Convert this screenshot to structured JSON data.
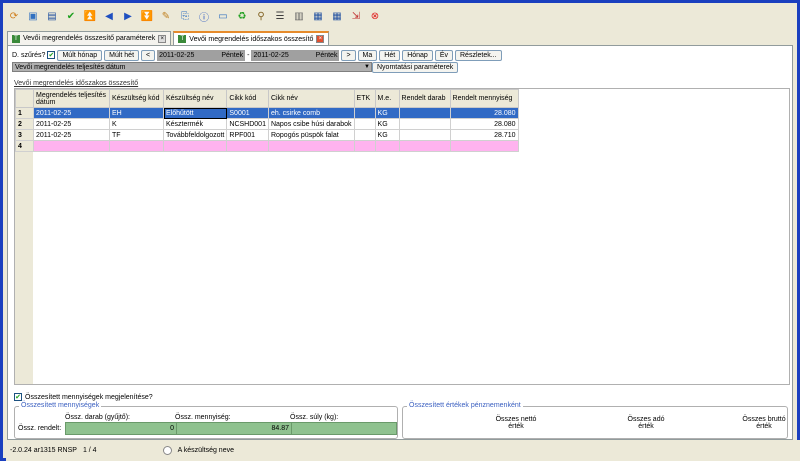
{
  "tabs": [
    {
      "label": "Vevői megrendelés összesítő paraméterek"
    },
    {
      "label": "Vevői megrendelés időszakos összesítő"
    }
  ],
  "filter": {
    "d_szures_label": "D. szűrés?",
    "mult_honap": "Múlt hónap",
    "mult_het": "Múlt hét",
    "prev": "<",
    "next": ">",
    "date_from": "2011-02-25",
    "day_from": "Péntek",
    "dash": "-",
    "date_to": "2011-02-25",
    "day_to": "Péntek",
    "ma": "Ma",
    "het": "Hét",
    "honap": "Hónap",
    "ev": "Év",
    "reszletek": "Részletek..."
  },
  "dropdown": {
    "value": "Vevői megrendelés teljesítés dátum",
    "print_btn": "Nyomtatási paraméterek"
  },
  "grid": {
    "title": "Vevői megrendelés időszakos összesítő",
    "columns": [
      "Megrendelés teljesítés dátum",
      "Készültség kód",
      "Készültség név",
      "Cikk kód",
      "Cikk név",
      "ETK",
      "M.e.",
      "Rendelt darab",
      "Rendelt mennyiség"
    ],
    "rows": [
      {
        "n": "1",
        "cells": [
          "2011-02-25",
          "EH",
          "Előhűtött",
          "S0001",
          "eh. csirke comb",
          "",
          "KG",
          "",
          "28.080"
        ]
      },
      {
        "n": "2",
        "cells": [
          "2011-02-25",
          "K",
          "Késztermék",
          "NCSHD001",
          "Napos csibe húsi darabok",
          "",
          "KG",
          "",
          "28.080"
        ]
      },
      {
        "n": "3",
        "cells": [
          "2011-02-25",
          "TF",
          "Továbbfeldolgozott",
          "RPF001",
          "Ropogós püspök falat",
          "",
          "KG",
          "",
          "28.710"
        ]
      },
      {
        "n": "4",
        "cells": [
          "",
          "",
          "",
          "",
          "",
          "",
          "",
          "",
          ""
        ]
      }
    ]
  },
  "bottom": {
    "show_totals_label": "Összesített mennyiségek megjelenítése?",
    "totals_legend": "Összesített mennyiségek",
    "col_darab": "Össz. darab (gyűjtő):",
    "col_menny": "Össz. mennyiség:",
    "col_suly": "Össz. súly (kg):",
    "row_label": "Össz. rendelt:",
    "val_darab": "0",
    "val_menny": "84.87",
    "val_suly": "",
    "values_legend": "Összesített értékek pénznemenként",
    "netto": "Összes nettó érték",
    "ado": "Összes adó érték",
    "brutto": "Összes bruttó érték"
  },
  "status": {
    "version": "-2.0.24 ar1315 RNSP",
    "record": "1 / 4",
    "hint": "A készültség neve"
  }
}
